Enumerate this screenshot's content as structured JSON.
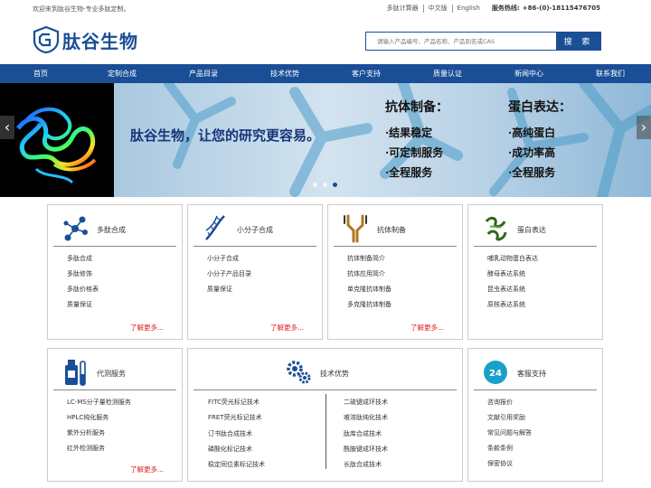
{
  "topbar": {
    "welcome": "欢迎来到肽谷生物-专业多肽定制。",
    "links": [
      "多肽计算器",
      "中文版",
      "English"
    ],
    "hotline_label": "服务热线:",
    "hotline": "+86-(0)-18115476705"
  },
  "header": {
    "logo_text": "肽谷生物",
    "search_placeholder": "请输入产品编号、产品名称、产品别名或CAS",
    "search_button": "搜 索"
  },
  "nav": [
    "首页",
    "定制合成",
    "产品目录",
    "技术优势",
    "客户支持",
    "质量认证",
    "新闻中心",
    "联系我们"
  ],
  "banner": {
    "slogan": "肽谷生物，让您的研究更容易。",
    "col1_title": "抗体制备：",
    "col1_items": [
      "·结果稳定",
      "·可定制服务",
      "·全程服务"
    ],
    "col2_title": "蛋白表达：",
    "col2_items": [
      "·高纯蛋白",
      "·成功率高",
      "·全程服务"
    ],
    "prev": "‹",
    "next": "›"
  },
  "cards": {
    "peptide": {
      "title": "多肽合成",
      "items": [
        "多肽合成",
        "多肽修饰",
        "多肽价格表",
        "质量保证"
      ],
      "more": "了解更多..."
    },
    "small_molecule": {
      "title": "小分子合成",
      "items": [
        "小分子合成",
        "小分子产品目录",
        "质量保证"
      ],
      "more": "了解更多..."
    },
    "antibody": {
      "title": "抗体制备",
      "items": [
        "抗体制备简介",
        "抗体应用简介",
        "单克隆抗体制备",
        "多克隆抗体制备"
      ],
      "more": "了解更多..."
    },
    "protein": {
      "title": "蛋白表达",
      "items": [
        "哺乳动物蛋白表达",
        "酵母表达系统",
        "昆虫表达系统",
        "原核表达系统"
      ],
      "more": "了解更多..."
    },
    "testing": {
      "title": "代测服务",
      "items": [
        "LC-MS分子量检测服务",
        "HPLC纯化服务",
        "紫外分析服务",
        "红外检测服务"
      ],
      "more": "了解更多..."
    },
    "tech": {
      "title": "技术优势",
      "col1": [
        "FITC荧光标记技术",
        "FRET荧光标记技术",
        "订书肽合成技术",
        "磷酸化标记技术",
        "稳定同位素标记技术"
      ],
      "col2": [
        "二硫键成环技术",
        "难溶肽纯化技术",
        "肽库合成技术",
        "酰胺键成环技术",
        "长肽合成技术"
      ]
    },
    "support": {
      "title": "客服支持",
      "items": [
        "咨询报价",
        "文献引用奖励",
        "常见问题与解答",
        "条款条例",
        "保密协议"
      ]
    }
  },
  "colors": {
    "brand": "#1a4e96",
    "more": "#e02020"
  }
}
